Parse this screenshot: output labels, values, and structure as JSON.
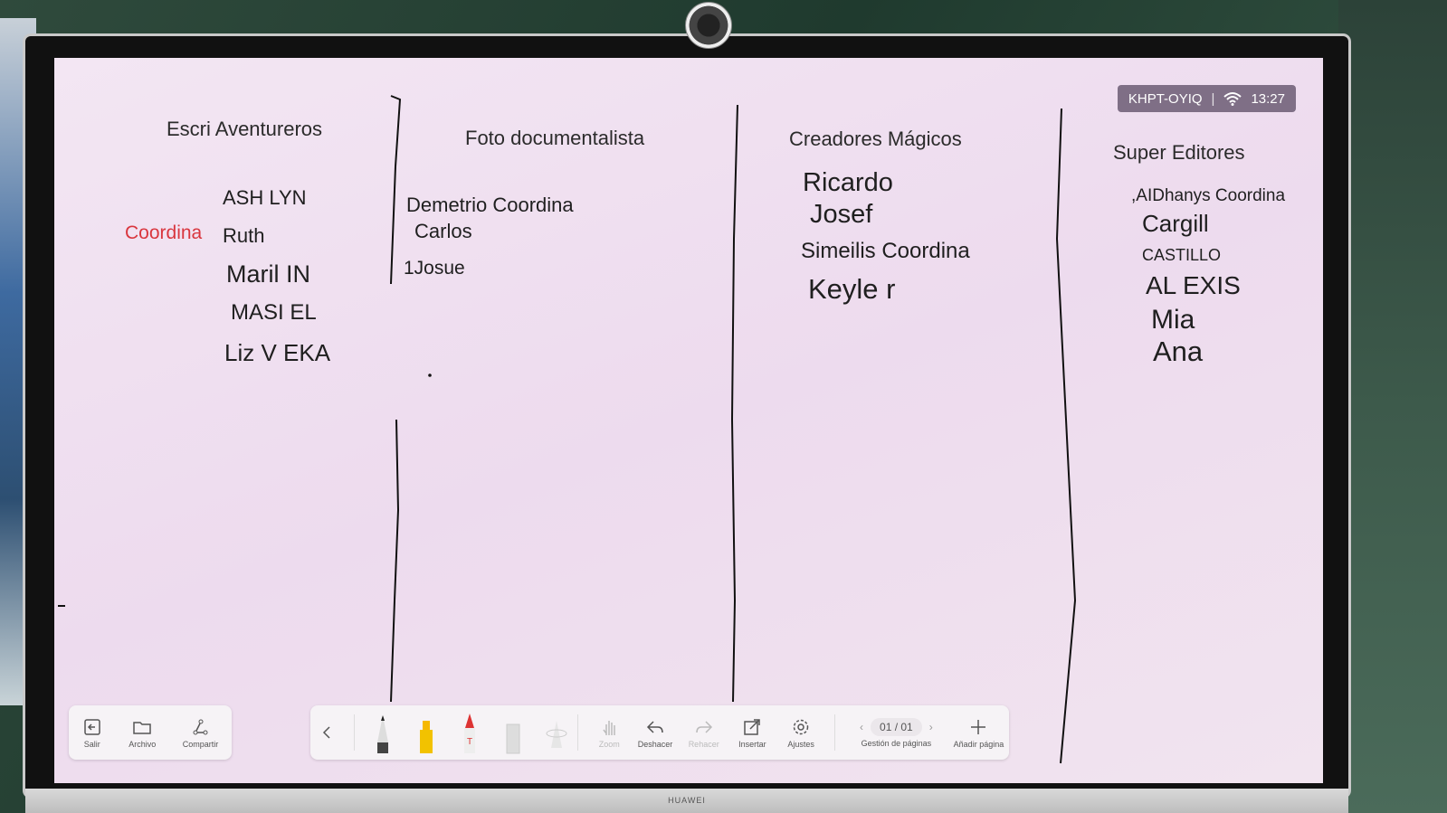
{
  "status_bar": {
    "code": "KHPT-OYIQ",
    "separator": "|",
    "time": "13:27"
  },
  "columns": [
    {
      "header": "Escri Aventureros",
      "coordinator_label": "Coordina",
      "names": [
        "ASH LYN",
        "Ruth",
        "Maril IN",
        "MASI EL",
        "Liz V EKA"
      ]
    },
    {
      "header": "Foto documentalista",
      "names": [
        "Demetrio Coordina",
        "Carlos",
        "1Josue"
      ]
    },
    {
      "header": "Creadores Mágicos",
      "names": [
        "Ricardo",
        "Josef",
        "Simeilis Coordina",
        "Keyle r"
      ]
    },
    {
      "header": "Super Editores",
      "names": [
        ",AIDhanys Coordina",
        "Cargill",
        "CASTILLO",
        "AL EXIS",
        "Mia",
        "Ana"
      ]
    }
  ],
  "toolbar_left": {
    "exit": "Salir",
    "file": "Archivo",
    "share": "Compartir"
  },
  "toolbar_main": {
    "zoom": "Zoom",
    "undo": "Deshacer",
    "redo": "Rehacer",
    "insert": "Insertar",
    "settings": "Ajustes",
    "page": "01 / 01",
    "page_mgmt": "Gestión de páginas",
    "add_page": "Añadir página"
  },
  "bezel": {
    "brand": "HUAWEI"
  },
  "colors": {
    "coordinator": "#d9363e",
    "status_bg": "#7f6f86",
    "screen_bg": "#f0e2f0"
  }
}
